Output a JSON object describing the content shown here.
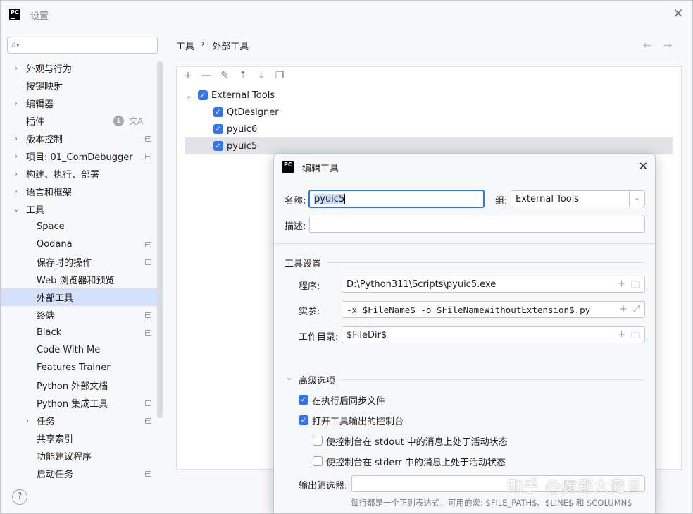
{
  "window": {
    "title": "设置",
    "logo": "PC"
  },
  "search": {
    "placeholder": "",
    "icon": "search-icon"
  },
  "sidebar": {
    "items": [
      {
        "label": "外观与行为"
      },
      {
        "label": "按键映射"
      },
      {
        "label": "编辑器"
      },
      {
        "label": "插件",
        "badge": "1",
        "lang_icon": "文A"
      },
      {
        "label": "版本控制"
      },
      {
        "label": "项目: 01_ComDebugger"
      },
      {
        "label": "构建、执行、部署"
      },
      {
        "label": "语言和框架"
      },
      {
        "label": "工具"
      },
      {
        "label": "Space"
      },
      {
        "label": "Qodana"
      },
      {
        "label": "保存时的操作"
      },
      {
        "label": "Web 浏览器和预览"
      },
      {
        "label": "外部工具"
      },
      {
        "label": "终端"
      },
      {
        "label": "Black"
      },
      {
        "label": "Code With Me"
      },
      {
        "label": "Features Trainer"
      },
      {
        "label": "Python 外部文档"
      },
      {
        "label": "Python 集成工具"
      },
      {
        "label": "任务"
      },
      {
        "label": "共享索引"
      },
      {
        "label": "功能建议程序"
      },
      {
        "label": "启动任务"
      }
    ]
  },
  "breadcrumb": {
    "parent": "工具",
    "separator": "›",
    "current": "外部工具"
  },
  "nav": {
    "back": "←",
    "forward": "→"
  },
  "toolbar": {
    "add": "+",
    "remove": "—",
    "edit": "✎",
    "up": "⇡",
    "down": "⇣",
    "copy": "❐"
  },
  "tree": {
    "group": "External Tools",
    "tools": [
      "QtDesigner",
      "pyuic6",
      "pyuic5"
    ]
  },
  "dialog": {
    "title": "编辑工具",
    "name_label": "名称:",
    "name_value": "pyuic5",
    "group_label": "组:",
    "group_value": "External Tools",
    "desc_label": "描述:",
    "desc_value": "",
    "tool_settings_title": "工具设置",
    "program_label": "程序:",
    "program_value": "D:\\Python311\\Scripts\\pyuic5.exe",
    "args_label": "实参:",
    "args_value": "-x $FileName$ -o $FileNameWithoutExtension$.py",
    "workdir_label": "工作目录:",
    "workdir_value": "$FileDir$",
    "advanced_title": "高级选项",
    "sync_label": "在执行后同步文件",
    "console_label": "打开工具输出的控制台",
    "stdout_label": "使控制台在 stdout 中的消息上处于活动状态",
    "stderr_label": "使控制台在 stderr 中的消息上处于活动状态",
    "filter_label": "输出筛选器:",
    "filter_value": "",
    "hint": "每行都是一个正则表达式，可用的宏: $FILE_PATH$、$LINE$ 和 $COLUMN$"
  },
  "help": {
    "label": "?"
  },
  "watermark": "知乎 @魔都大佬目",
  "colors": {
    "accent": "#3574f0",
    "selection": "#d5e1fb"
  }
}
